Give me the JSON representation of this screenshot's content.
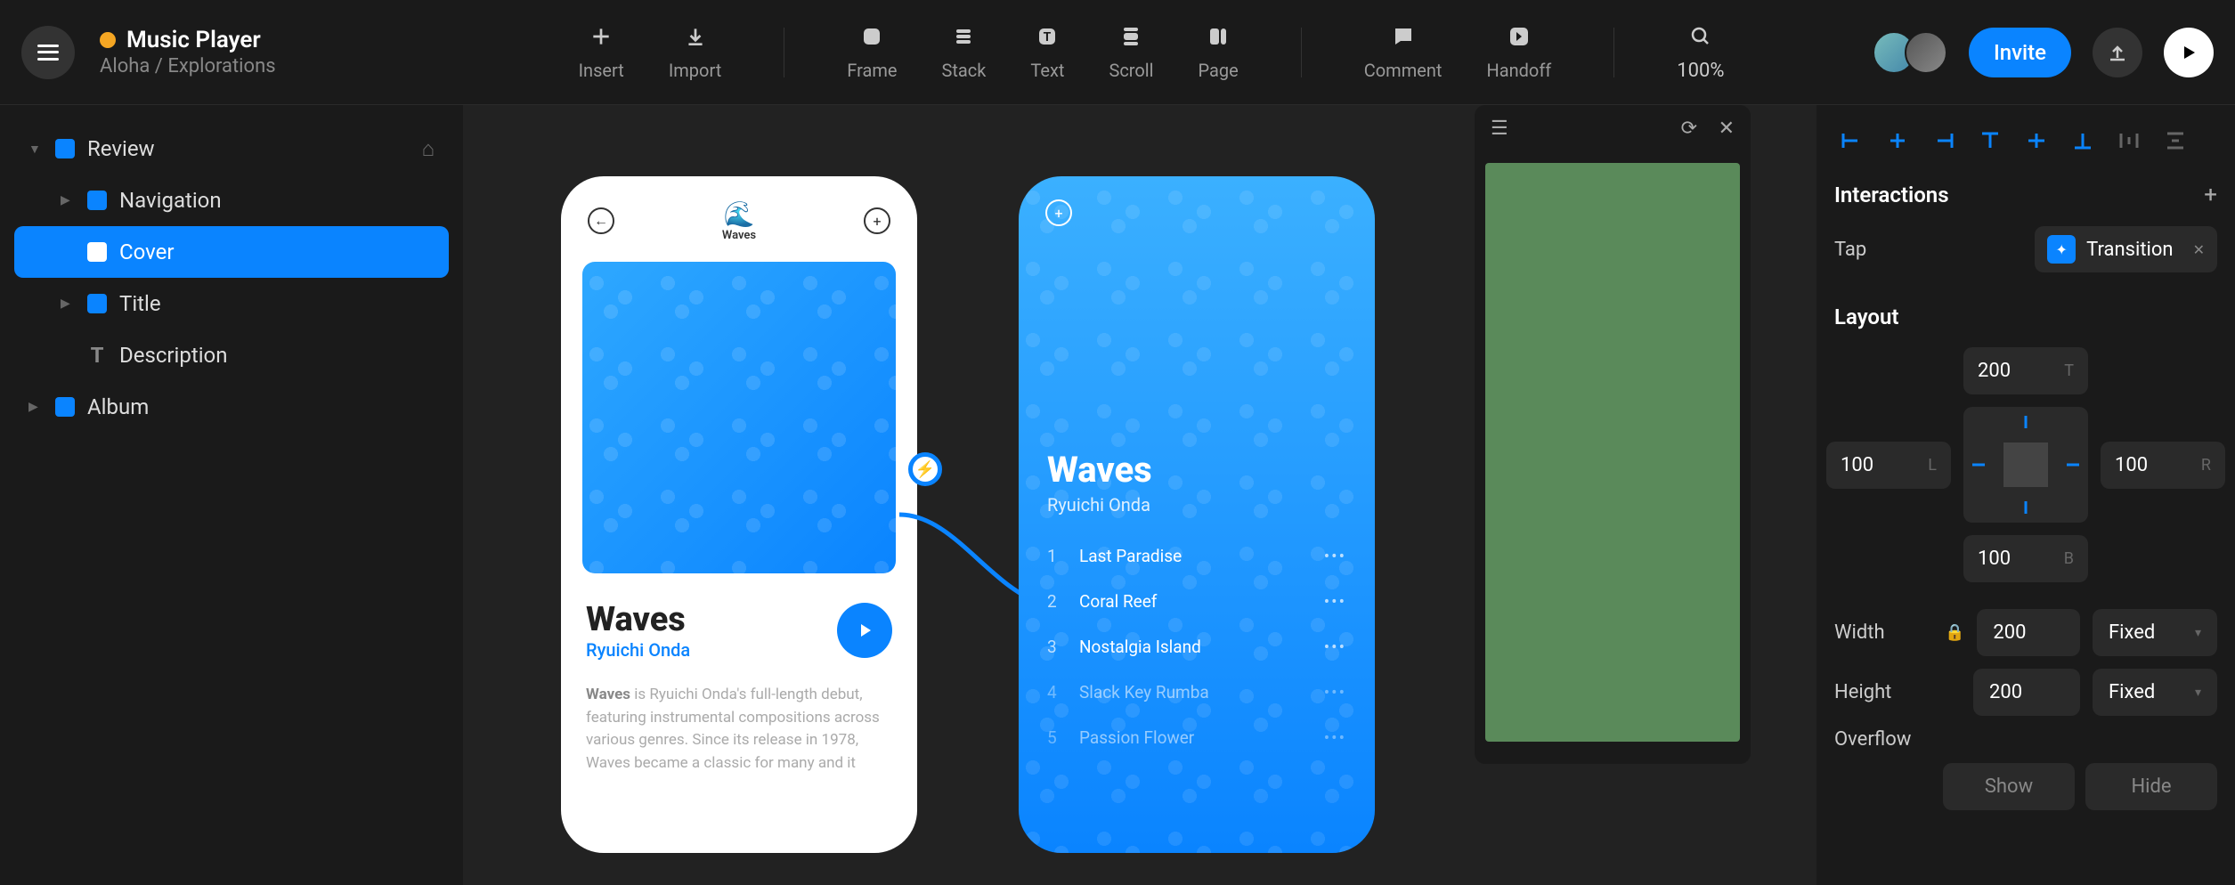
{
  "header": {
    "app_title": "Music Player",
    "breadcrumb": "Aloha / Explorations",
    "zoom": "100%",
    "invite": "Invite"
  },
  "tools": {
    "insert": "Insert",
    "import": "Import",
    "frame": "Frame",
    "stack": "Stack",
    "text": "Text",
    "scroll": "Scroll",
    "page": "Page",
    "comment": "Comment",
    "handoff": "Handoff"
  },
  "tree": {
    "review": "Review",
    "navigation": "Navigation",
    "cover": "Cover",
    "title": "Title",
    "description": "Description",
    "album": "Album"
  },
  "canvas": {
    "phone1": {
      "logo_text": "Waves",
      "album_title": "Waves",
      "album_artist": "Ryuichi Onda",
      "desc_bold": "Waves",
      "desc_rest": " is Ryuichi Onda's full-length debut, featuring instrumental compositions across various genres. Since its release in 1978, Waves became a classic for many and it"
    },
    "phone2": {
      "album_title": "Waves",
      "album_artist": "Ryuichi Onda",
      "tracks": [
        {
          "n": "1",
          "name": "Last Paradise"
        },
        {
          "n": "2",
          "name": "Coral Reef"
        },
        {
          "n": "3",
          "name": "Nostalgia Island"
        },
        {
          "n": "4",
          "name": "Slack Key Rumba"
        },
        {
          "n": "5",
          "name": "Passion Flower"
        }
      ]
    }
  },
  "inspector": {
    "interactions_title": "Interactions",
    "tap_label": "Tap",
    "transition_label": "Transition",
    "layout_title": "Layout",
    "t": "200",
    "l": "100",
    "r": "100",
    "b": "100",
    "t_suffix": "T",
    "l_suffix": "L",
    "r_suffix": "R",
    "b_suffix": "B",
    "width_label": "Width",
    "width_val": "200",
    "width_mode": "Fixed",
    "height_label": "Height",
    "height_val": "200",
    "height_mode": "Fixed",
    "overflow_label": "Overflow",
    "show": "Show",
    "hide": "Hide"
  }
}
